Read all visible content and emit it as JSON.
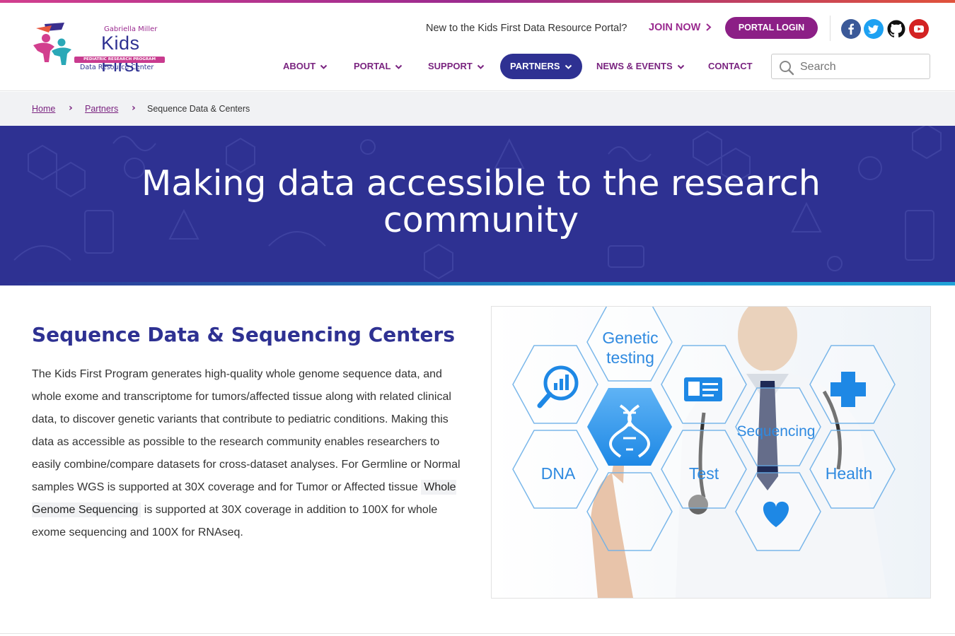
{
  "header": {
    "logo": {
      "sub": "Gabriella Miller",
      "main": "Kids First",
      "band": "PEDIATRIC RESEARCH PROGRAM",
      "drc": "Data Resource Center"
    },
    "join_prompt": "New to the Kids First Data Resource Portal?",
    "join_link": "JOIN NOW",
    "portal_login": "PORTAL LOGIN",
    "social": [
      "facebook-icon",
      "twitter-icon",
      "github-icon",
      "youtube-icon"
    ],
    "nav": [
      {
        "label": "ABOUT",
        "dropdown": true,
        "active": false
      },
      {
        "label": "PORTAL",
        "dropdown": true,
        "active": false
      },
      {
        "label": "SUPPORT",
        "dropdown": true,
        "active": false
      },
      {
        "label": "PARTNERS",
        "dropdown": true,
        "active": true
      },
      {
        "label": "NEWS & EVENTS",
        "dropdown": true,
        "active": false
      },
      {
        "label": "CONTACT",
        "dropdown": false,
        "active": false
      }
    ],
    "search_placeholder": "Search"
  },
  "breadcrumb": {
    "home": "Home",
    "partners": "Partners",
    "current": "Sequence Data & Centers"
  },
  "hero": {
    "title": "Making data accessible to the research community"
  },
  "main": {
    "title": "Sequence Data & Sequencing Centers",
    "para_before": "The Kids First Program generates high-quality whole genome sequence data, and whole exome and transcriptome for tumors/affected tissue along with related clinical data, to discover genetic variants that contribute to pediatric conditions. Making this data as accessible as possible to the research community enables researchers to easily combine/compare datasets for cross-dataset analyses. For Germline or Normal samples WGS is supported at 30X coverage and for Tumor or Affected tissue",
    "para_highlight": "Whole Genome Sequencing",
    "para_after": "is supported at 30X coverage in addition to 100X for whole exome sequencing and 100X for RNAseq."
  },
  "figure": {
    "labels": {
      "genetic": "Genetic",
      "testing": "testing",
      "sequencing": "Sequencing",
      "dna": "DNA",
      "test": "Test",
      "health": "Health"
    }
  },
  "colors": {
    "brand_purple": "#8c1f86",
    "brand_navy": "#2e3192",
    "accent_blue": "#1e88e5"
  }
}
